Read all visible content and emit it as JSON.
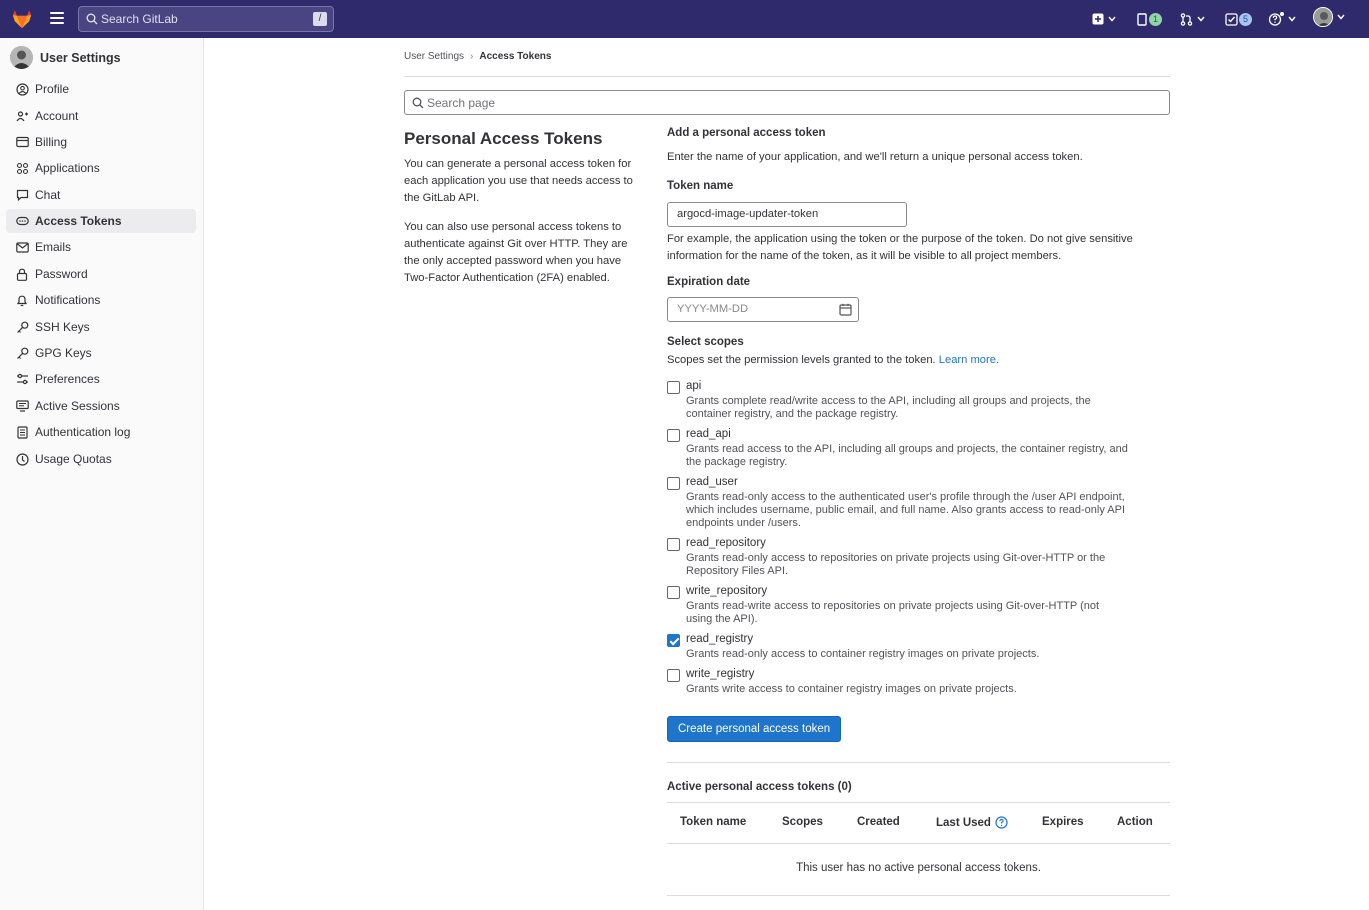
{
  "topbar": {
    "search_placeholder": "Search GitLab",
    "search_shortcut": "/",
    "issues_count": "1",
    "todos_count": "5"
  },
  "sidebar": {
    "title": "User Settings",
    "items": [
      {
        "label": "Profile"
      },
      {
        "label": "Account"
      },
      {
        "label": "Billing"
      },
      {
        "label": "Applications"
      },
      {
        "label": "Chat"
      },
      {
        "label": "Access Tokens"
      },
      {
        "label": "Emails"
      },
      {
        "label": "Password"
      },
      {
        "label": "Notifications"
      },
      {
        "label": "SSH Keys"
      },
      {
        "label": "GPG Keys"
      },
      {
        "label": "Preferences"
      },
      {
        "label": "Active Sessions"
      },
      {
        "label": "Authentication log"
      },
      {
        "label": "Usage Quotas"
      }
    ]
  },
  "breadcrumb": {
    "parent": "User Settings",
    "separator": "›",
    "current": "Access Tokens"
  },
  "page_search": {
    "placeholder": "Search page"
  },
  "intro": {
    "title": "Personal Access Tokens",
    "p1": "You can generate a personal access token for each application you use that needs access to the GitLab API.",
    "p2": "You can also use personal access tokens to authenticate against Git over HTTP. They are the only accepted password when you have Two-Factor Authentication (2FA) enabled."
  },
  "form": {
    "heading": "Add a personal access token",
    "description": "Enter the name of your application, and we'll return a unique personal access token.",
    "token_name_label": "Token name",
    "token_name_value": "argocd-image-updater-token",
    "token_name_help_1": "For example, the application using the token or the purpose of the token. Do not give sensitive",
    "token_name_help_2": "information for the name of the token, as it will be visible to all project members.",
    "expiration_label": "Expiration date",
    "expiration_placeholder": "YYYY-MM-DD",
    "scopes_label": "Select scopes",
    "scopes_help": "Scopes set the permission levels granted to the token.",
    "learn_more": "Learn more.",
    "scopes": [
      {
        "name": "api",
        "checked": false,
        "desc": [
          "Grants complete read/write access to the API, including all groups and projects, the",
          "container registry, and the package registry."
        ]
      },
      {
        "name": "read_api",
        "checked": false,
        "desc": [
          "Grants read access to the API, including all groups and projects, the container registry, and",
          "the package registry."
        ]
      },
      {
        "name": "read_user",
        "checked": false,
        "desc": [
          "Grants read-only access to the authenticated user's profile through the /user API endpoint,",
          "which includes username, public email, and full name. Also grants access to read-only API",
          "endpoints under /users."
        ]
      },
      {
        "name": "read_repository",
        "checked": false,
        "desc": [
          "Grants read-only access to repositories on private projects using Git-over-HTTP or the",
          "Repository Files API."
        ]
      },
      {
        "name": "write_repository",
        "checked": false,
        "desc": [
          "Grants read-write access to repositories on private projects using Git-over-HTTP (not",
          "using the API)."
        ]
      },
      {
        "name": "read_registry",
        "checked": true,
        "desc": [
          "Grants read-only access to container registry images on private projects."
        ]
      },
      {
        "name": "write_registry",
        "checked": false,
        "desc": [
          "Grants write access to container registry images on private projects."
        ]
      }
    ],
    "submit_label": "Create personal access token"
  },
  "active_tokens": {
    "heading": "Active personal access tokens (0)",
    "columns": [
      "Token name",
      "Scopes",
      "Created",
      "Last Used",
      "Expires",
      "Action"
    ],
    "empty_message": "This user has no active personal access tokens."
  },
  "colors": {
    "topbar": "#2f2a6b",
    "primary": "#1f75cb",
    "text": "#333238"
  }
}
